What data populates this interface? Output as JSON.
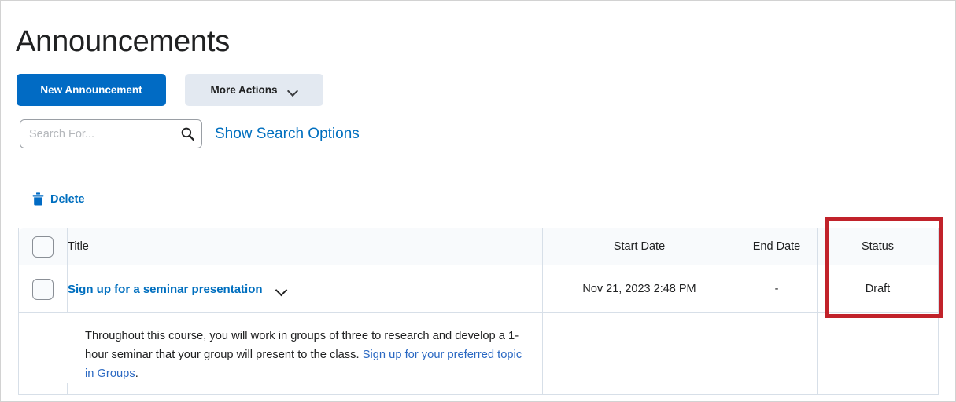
{
  "page": {
    "title": "Announcements"
  },
  "toolbar": {
    "new_announcement_label": "New Announcement",
    "more_actions_label": "More Actions"
  },
  "search": {
    "placeholder": "Search For...",
    "value": "",
    "icon": "search-icon",
    "show_options_link": "Show Search Options"
  },
  "actions": {
    "delete_label": "Delete",
    "delete_icon": "trash-icon"
  },
  "table": {
    "columns": [
      {
        "key": "check",
        "label": ""
      },
      {
        "key": "title",
        "label": "Title"
      },
      {
        "key": "start",
        "label": "Start Date"
      },
      {
        "key": "end",
        "label": "End Date"
      },
      {
        "key": "status",
        "label": "Status"
      }
    ],
    "rows": [
      {
        "title": "Sign up for a seminar presentation",
        "start_date": "Nov 21, 2023 2:48 PM",
        "end_date": "-",
        "status": "Draft",
        "expand_icon": "chevron-down-icon",
        "excerpt_before": "Throughout this course, you will work in groups of three to research and develop a 1-hour seminar that your group will present to the class. ",
        "excerpt_link": "Sign up for your preferred topic in Groups",
        "excerpt_after": "."
      }
    ]
  },
  "annotation": {
    "color": "#c1222a",
    "highlights_column": "Status"
  },
  "colors": {
    "primary_button": "#016bc4",
    "secondary_button": "#e3e9f1",
    "link": "#006fbf",
    "annotation": "#c1222a",
    "table_header_bg": "#f8fafc",
    "table_border": "#d7dfe8"
  }
}
